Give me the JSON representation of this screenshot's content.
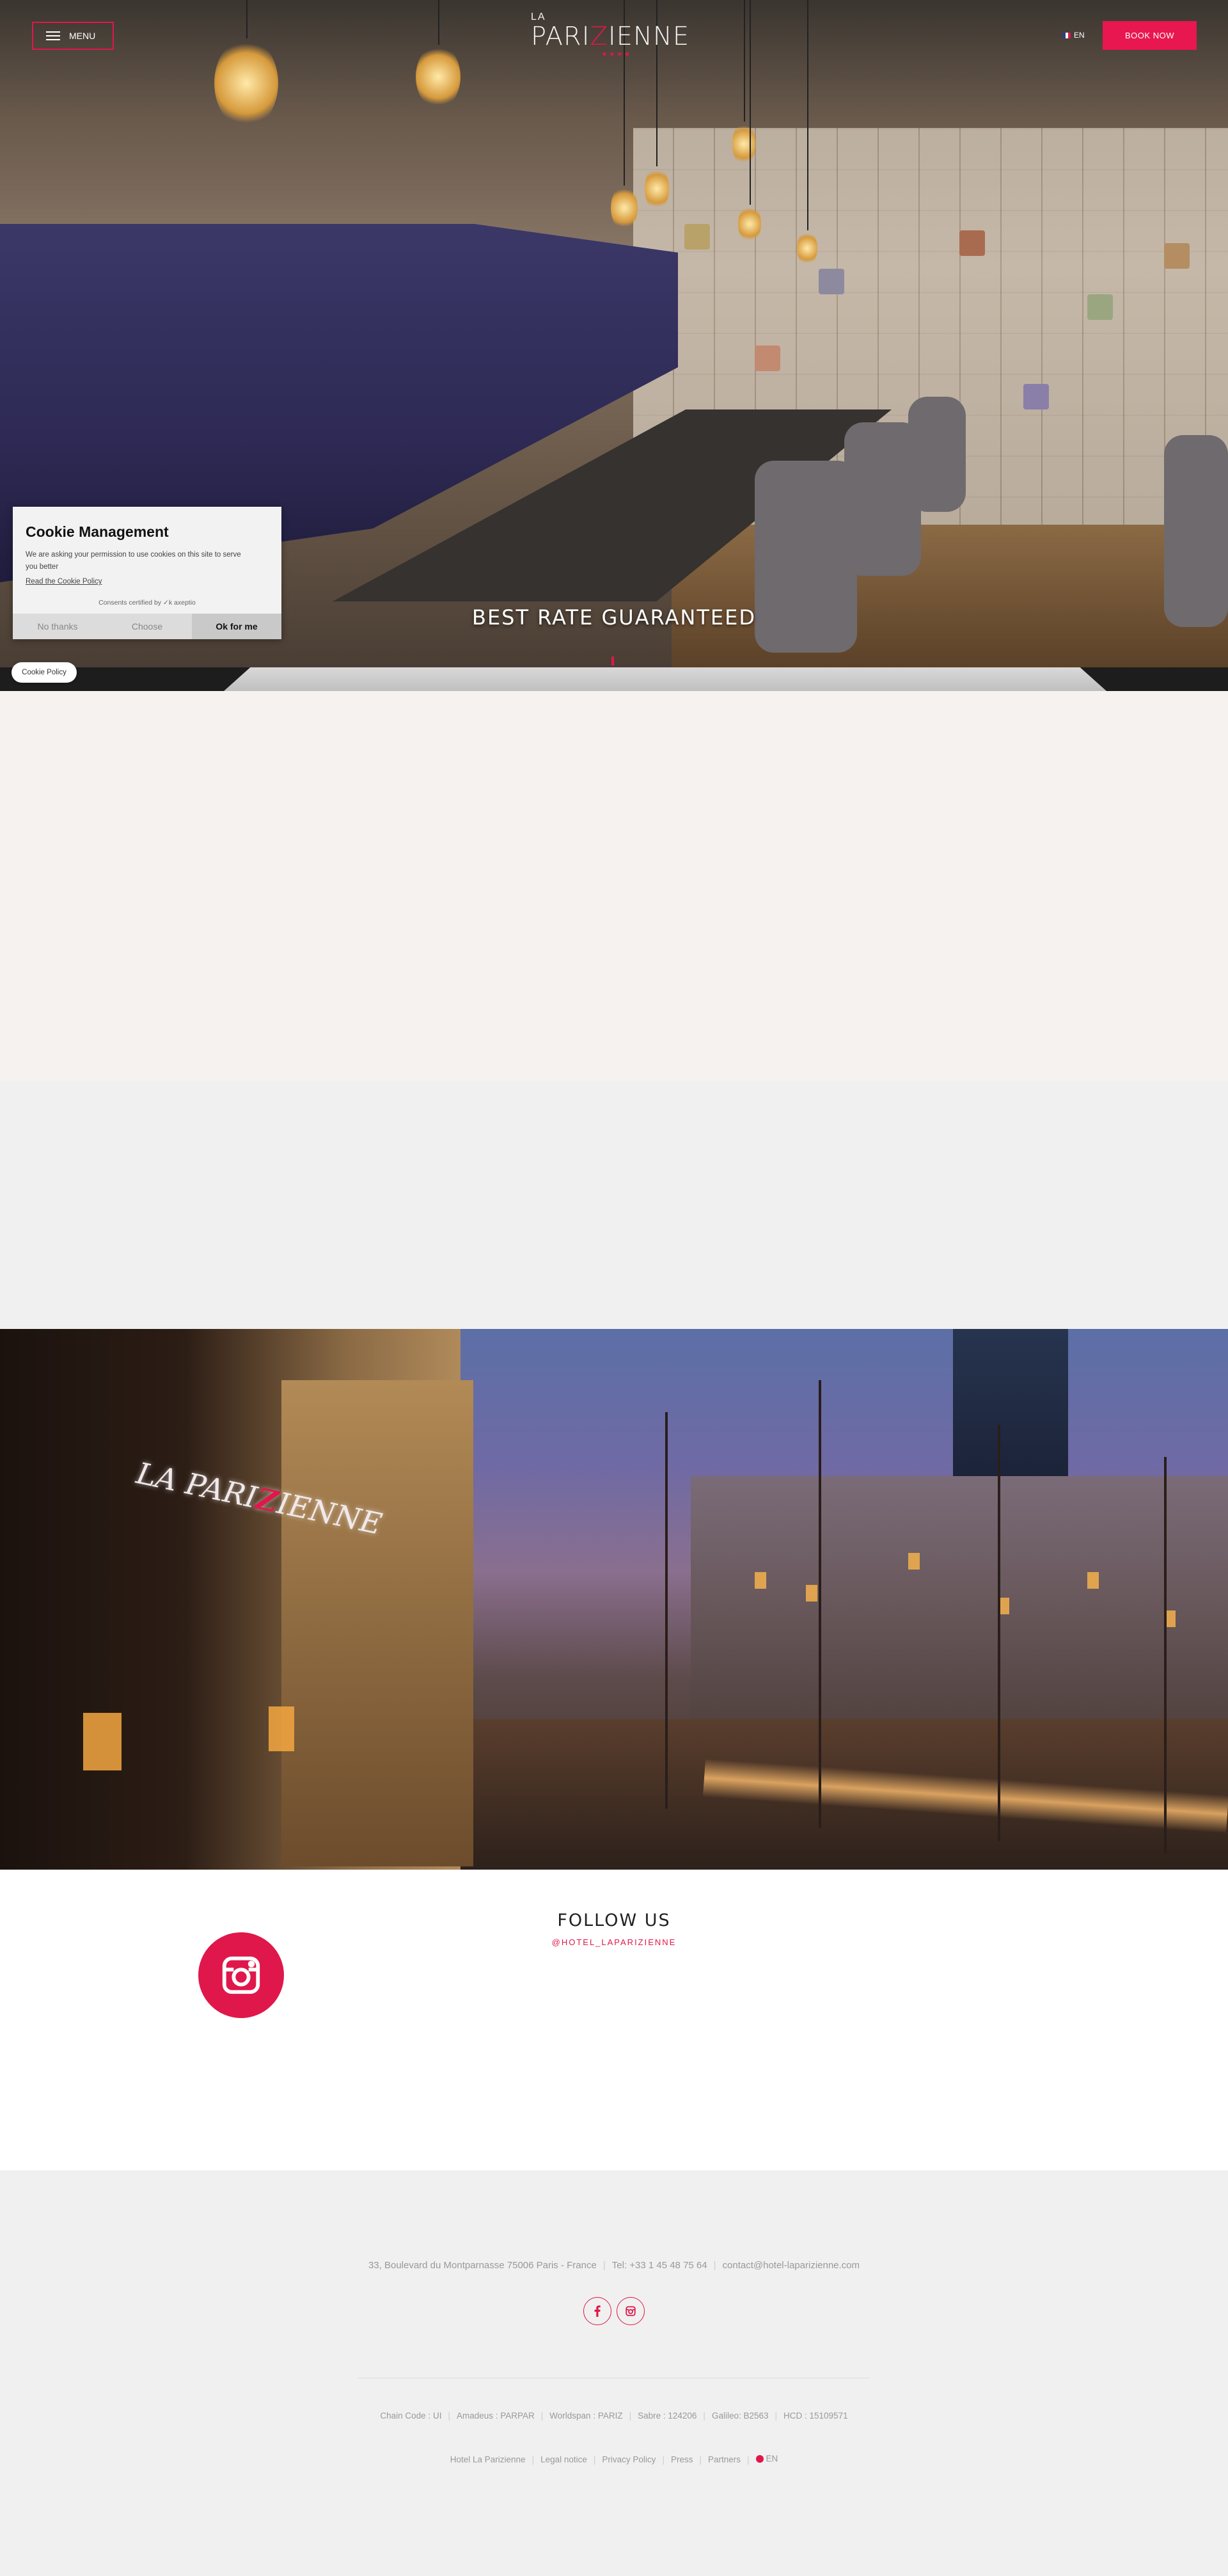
{
  "header": {
    "menu_label": "MENU",
    "logo_top": "LA",
    "logo_main_a": "PARI",
    "logo_main_q": "Z",
    "logo_main_b": "IENNE",
    "logo_sub": "",
    "lang_label": "EN",
    "book_label": "BOOK NOW"
  },
  "hero": {
    "title": "BEST RATE GUARANTEED"
  },
  "cookie": {
    "title": "Cookie Management",
    "text": "We are asking your permission to use cookies on this site to serve you better",
    "link": "Read the Cookie Policy",
    "certified": "Consents certified by ✓k axeptio",
    "no_label": "No thanks",
    "choose_label": "Choose",
    "ok_label": "Ok for me",
    "policy_pill": "Cookie Policy"
  },
  "street": {
    "sign_a": "LA PARI",
    "sign_q": "Z",
    "sign_b": "IENNE"
  },
  "follow": {
    "title": "FOLLOW US",
    "handle": "@HOTEL_LAPARIZIENNE"
  },
  "footer": {
    "address": "33, Boulevard du Montparnasse 75006 Paris - France",
    "tel": "Tel: +33 1 45 48 75 64",
    "email": "contact@hotel-laparizienne.com",
    "codes": [
      "Chain Code : UI",
      "Amadeus : PARPAR",
      "Worldspan : PARIZ",
      "Sabre : 124206",
      "Galileo: B2563",
      "HCD : 15109571"
    ],
    "links": [
      "Hotel La Parizienne",
      "Legal notice",
      "Privacy Policy",
      "Press",
      "Partners"
    ],
    "lang": "EN"
  },
  "colors": {
    "accent": "#e0174a",
    "footer_bg": "#f0f0f0",
    "beige": "#f5f2ef"
  },
  "icons": [
    "hamburger-icon",
    "flag-icon",
    "instagram-icon",
    "facebook-icon"
  ]
}
